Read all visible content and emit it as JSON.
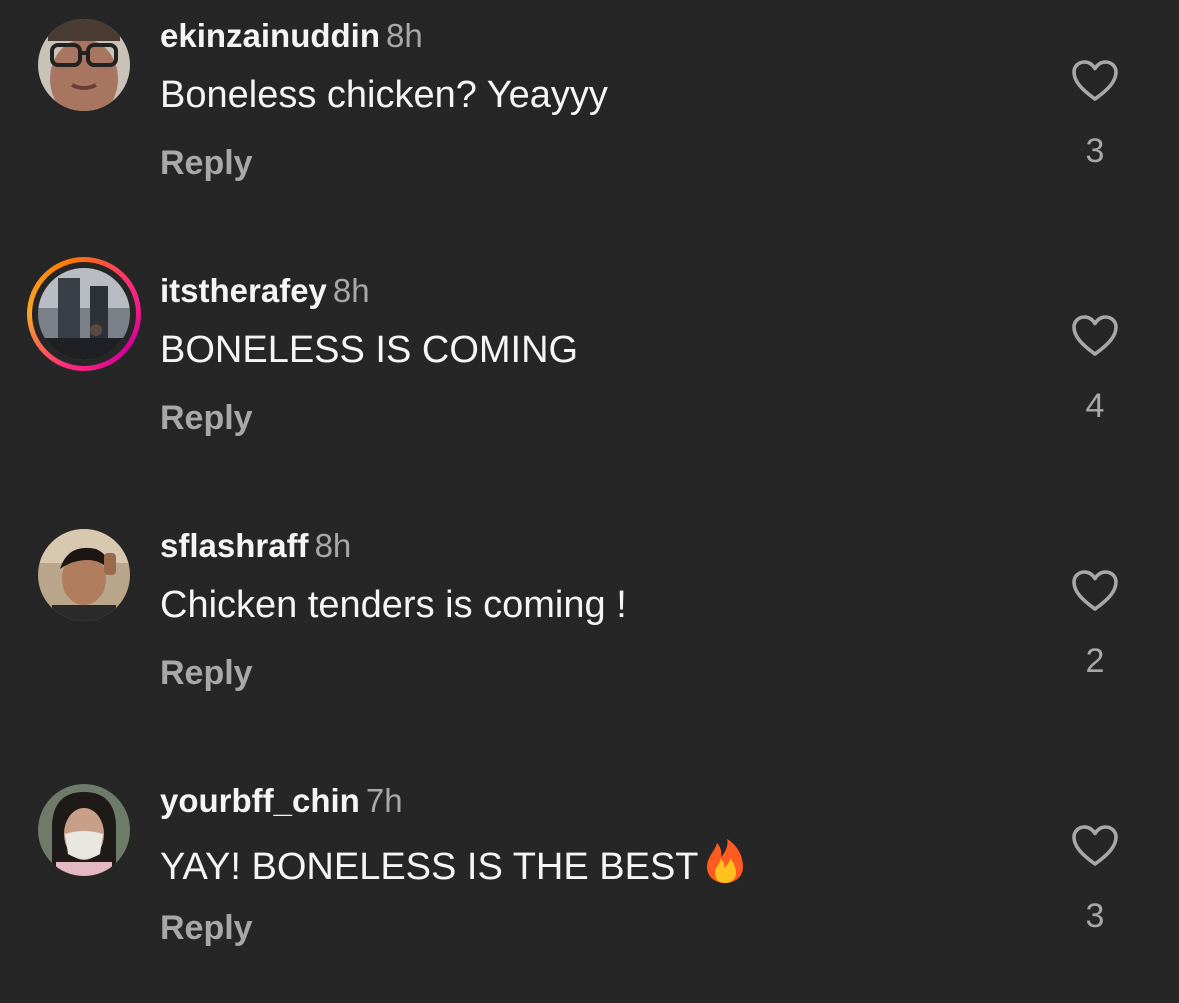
{
  "comments": [
    {
      "username": "ekinzainuddin",
      "time": "8h",
      "text": "Boneless chicken? Yeayyy",
      "reply_label": "Reply",
      "likes": "3",
      "avatar": "avatar-glasses-person",
      "story_ring": false
    },
    {
      "username": "itstherafey",
      "time": "8h",
      "text": "BONELESS IS COMING",
      "reply_label": "Reply",
      "likes": "4",
      "avatar": "avatar-building-photo",
      "story_ring": true
    },
    {
      "username": "sflashraff",
      "time": "8h",
      "text": "Chicken tenders is coming !",
      "reply_label": "Reply",
      "likes": "2",
      "avatar": "avatar-young-man",
      "story_ring": false
    },
    {
      "username": "yourbff_chin",
      "time": "7h",
      "text": "YAY! BONELESS IS THE BEST",
      "text_emoji": "fire-icon",
      "reply_label": "Reply",
      "likes": "3",
      "avatar": "avatar-masked-woman",
      "story_ring": false
    }
  ],
  "colors": {
    "background": "#262626",
    "primary_text": "#f5f5f5",
    "secondary_text": "#a8a8a8",
    "story_ring_start": "#ff2d7a",
    "story_ring_end": "#f9a825"
  }
}
